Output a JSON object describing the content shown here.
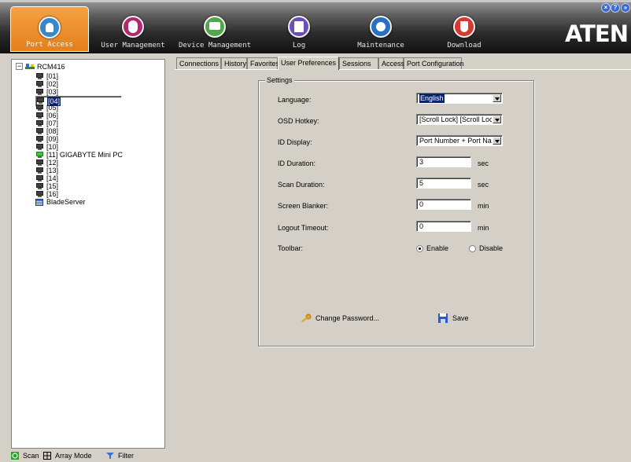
{
  "topbar": {
    "nav": [
      {
        "label": "Port Access",
        "icon": "port-access-icon",
        "color": "#3a87c8",
        "active": true
      },
      {
        "label": "User Management",
        "icon": "user-management-icon",
        "color": "#b0286e"
      },
      {
        "label": "Device Management",
        "icon": "device-management-icon",
        "color": "#52a64a"
      },
      {
        "label": "Log",
        "icon": "log-icon",
        "color": "#6b4fb8"
      },
      {
        "label": "Maintenance",
        "icon": "maintenance-icon",
        "color": "#2a6fc0"
      },
      {
        "label": "Download",
        "icon": "download-icon",
        "color": "#d63a2e"
      }
    ],
    "logo": "ATEN",
    "corner_icons": [
      "close-icon",
      "help-icon",
      "logout-icon"
    ]
  },
  "tree": {
    "root_label": "RCM416",
    "nodes": [
      {
        "label": "[01]"
      },
      {
        "label": "[02]"
      },
      {
        "label": "[03]"
      },
      {
        "label": "[04]",
        "selected": true
      },
      {
        "label": "[05]"
      },
      {
        "label": "[06]"
      },
      {
        "label": "[07]"
      },
      {
        "label": "[08]"
      },
      {
        "label": "[09]"
      },
      {
        "label": "[10]"
      },
      {
        "label": "[11] GIGABYTE Mini PC",
        "online": true
      },
      {
        "label": "[12]"
      },
      {
        "label": "[13]"
      },
      {
        "label": "[14]"
      },
      {
        "label": "[15]"
      },
      {
        "label": "[16]"
      }
    ],
    "blade_label": "BladeServer"
  },
  "bottom": {
    "scan": "Scan",
    "array_mode": "Array Mode",
    "filter": "Filter"
  },
  "tabs": [
    "Connections",
    "History",
    "Favorites",
    "User Preferences",
    "Sessions",
    "Access",
    "Port Configuration"
  ],
  "active_tab": "User Preferences",
  "settings": {
    "legend": "Settings",
    "language": {
      "label": "Language:",
      "value": "English"
    },
    "osd_hotkey": {
      "label": "OSD Hotkey:",
      "value": "[Scroll Lock] [Scroll Loc"
    },
    "id_display": {
      "label": "ID Display:",
      "value": "Port Number + Port Nam"
    },
    "id_duration": {
      "label": "ID Duration:",
      "value": "3",
      "unit": "sec"
    },
    "scan_duration": {
      "label": "Scan Duration:",
      "value": "5",
      "unit": "sec"
    },
    "screen_blanker": {
      "label": "Screen Blanker:",
      "value": "0",
      "unit": "min"
    },
    "logout_timeout": {
      "label": "Logout Timeout:",
      "value": "0",
      "unit": "min"
    },
    "toolbar": {
      "label": "Toolbar:",
      "enable": "Enable",
      "disable": "Disable",
      "selected": "Enable"
    }
  },
  "actions": {
    "change_password": "Change Password...",
    "save": "Save"
  }
}
